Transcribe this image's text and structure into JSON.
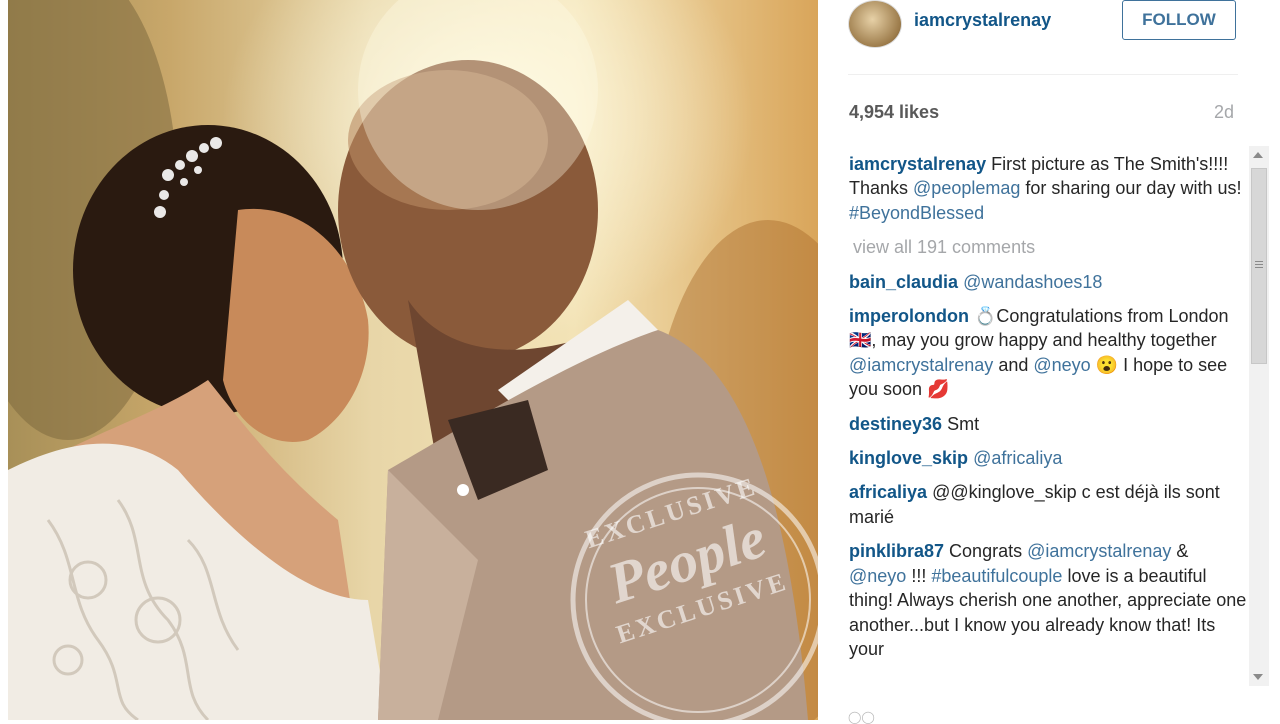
{
  "post": {
    "username": "iamcrystalrenay",
    "follow_label": "FOLLOW",
    "likes": "4,954 likes",
    "time_ago": "2d",
    "view_all": "view all 191 comments"
  },
  "watermark": {
    "top": "EXCLUSIVE",
    "brand": "People",
    "bottom": "EXCLUSIVE"
  },
  "caption": {
    "user": "iamcrystalrenay",
    "t1": " First picture as The Smith's!!!! Thanks ",
    "mention": "@peoplemag",
    "t2": " for sharing our day with us! ",
    "hashtag": "#BeyondBlessed"
  },
  "comments": [
    {
      "user": "bain_claudia",
      "text": "",
      "mention": "@wandashoes18"
    },
    {
      "user": "imperolondon",
      "t1": " 💍Congratulations from London 🇬🇧, may you grow happy and healthy together ",
      "m1": "@iamcrystalrenay",
      "t2": " and ",
      "m2": "@neyo",
      "t3": " 😮 I hope to see you soon 💋"
    },
    {
      "user": "destiney36",
      "text": " Smt"
    },
    {
      "user": "kinglove_skip",
      "mention": "@africaliya"
    },
    {
      "user": "africaliya",
      "text": " @@kinglove_skip c est déjà ils sont marié"
    },
    {
      "user": "pinklibra87",
      "t1": " Congrats ",
      "m1": "@iamcrystalrenay",
      "t2": " & ",
      "m2": "@neyo",
      "t3": " !!! ",
      "m3": "#beautifulcouple",
      "t4": " love is a beautiful thing! Always cherish one another, appreciate one another...but I know you already know that! Its your"
    }
  ],
  "icons": {
    "avatar": "avatar",
    "scroll_up": "chevron-up-icon",
    "scroll_down": "chevron-down-icon"
  }
}
